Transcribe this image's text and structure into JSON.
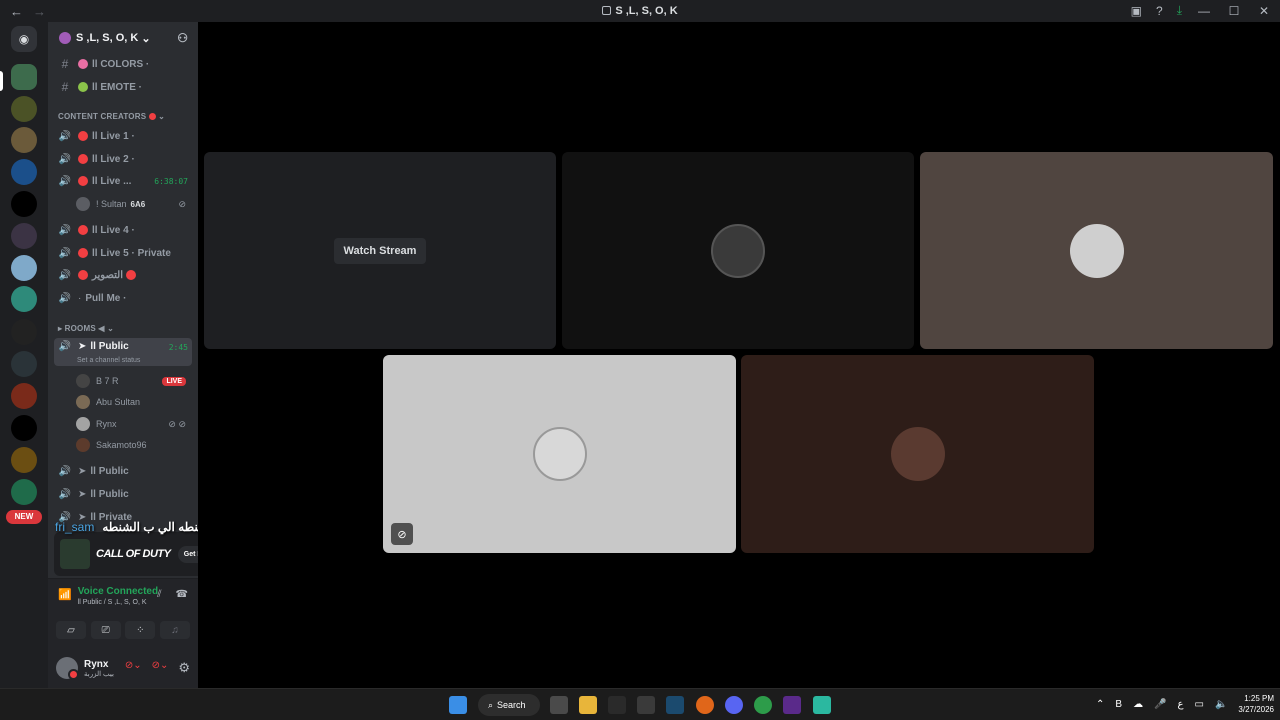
{
  "window": {
    "title": "S ,L, S, O, K"
  },
  "server": {
    "name": "S ,L, S, O, K"
  },
  "channels_top": [
    {
      "name": "ll COLORS ·"
    },
    {
      "name": "ll EMOTE ·"
    }
  ],
  "category_creators": {
    "label": "CONTENT CREATORS"
  },
  "creator_channels": [
    {
      "name": "ll Live 1 ·"
    },
    {
      "name": "ll Live 2 ·"
    },
    {
      "name": "ll Live ...",
      "timer": "6:38:07"
    },
    {
      "name": "ll Live 4 ·"
    },
    {
      "name": "ll Live 5 · Private"
    },
    {
      "name": "التصوير"
    },
    {
      "name": "Pull Me ·"
    }
  ],
  "live3_user": {
    "name": "! Sultan",
    "tag": "6A6"
  },
  "category_rooms": {
    "label": "ROOMS ◀"
  },
  "public_active": {
    "name": "ll Public",
    "timer": "2:45",
    "status": "Set a channel status"
  },
  "voice_users": [
    {
      "name": "B 7 R",
      "live": "LIVE"
    },
    {
      "name": "Abu Sultan"
    },
    {
      "name": "Rynx"
    },
    {
      "name": "Sakamoto96"
    }
  ],
  "rooms_more": [
    {
      "name": "ll Public"
    },
    {
      "name": "ll Public"
    },
    {
      "name": "ll Private"
    }
  ],
  "new_badge": "NEW",
  "promo": {
    "name": "CALL OF DUTY",
    "button": "Get Reward!"
  },
  "overlay": {
    "user": "fri_sam",
    "text": "ثواني توثيقي الي ب الشنطه الي ب الشنطه"
  },
  "voice": {
    "title": "Voice Connected",
    "sub": "ll Public / S ,L, S, O, K"
  },
  "user": {
    "name": "Rynx",
    "status": "بيب الزربة"
  },
  "stage": {
    "watch_label": "Watch Stream"
  },
  "taskbar": {
    "search": "Search",
    "time": "1:25 PM",
    "date": "3/27/2026",
    "lang": "ع"
  }
}
